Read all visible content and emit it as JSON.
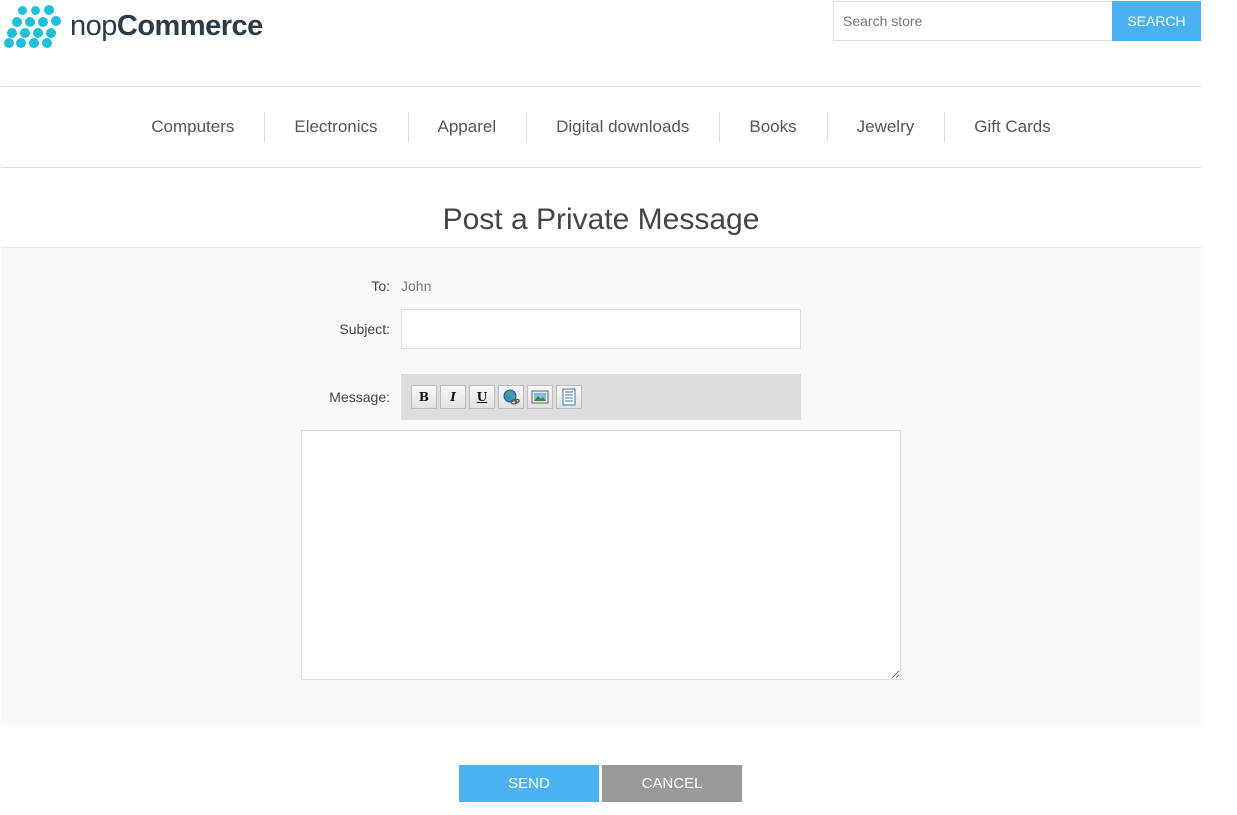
{
  "header": {
    "logo": {
      "part1": "nop",
      "part2": "Commerce",
      "icon": "nopcommerce-dots-logo",
      "color": "#1ec0d8"
    },
    "search": {
      "placeholder": "Search store",
      "value": "",
      "button_label": "SEARCH",
      "button_color": "#4ab2f1"
    }
  },
  "menu": {
    "items": [
      "Computers",
      "Electronics",
      "Apparel",
      "Digital downloads",
      "Books",
      "Jewelry",
      "Gift Cards"
    ]
  },
  "page": {
    "title": "Post a Private Message"
  },
  "form": {
    "to_label": "To:",
    "to_value": "John",
    "subject_label": "Subject:",
    "subject_value": "",
    "message_label": "Message:",
    "message_value": "",
    "toolbar": [
      {
        "label": "B",
        "icon": "bold-icon"
      },
      {
        "label": "I",
        "icon": "italic-icon"
      },
      {
        "label": "U",
        "icon": "underline-icon"
      },
      {
        "label": "",
        "icon": "insert-link-icon"
      },
      {
        "label": "",
        "icon": "insert-image-icon"
      },
      {
        "label": "",
        "icon": "quote-icon"
      }
    ]
  },
  "buttons": {
    "send_label": "SEND",
    "send_color": "#4ab2f1",
    "cancel_label": "CANCEL",
    "cancel_color": "#999999"
  }
}
